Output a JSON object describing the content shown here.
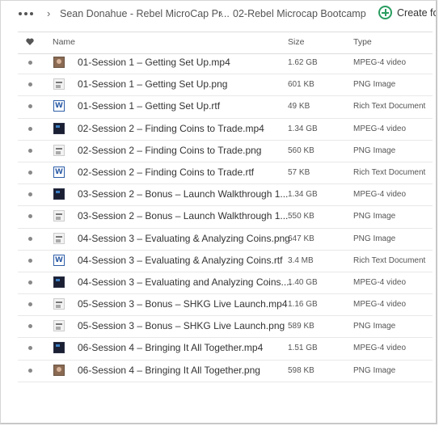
{
  "breadcrumb": {
    "items": [
      "Sean Donahue - Rebel MicroCap Pr...",
      "02-Rebel Microcap Bootcamp"
    ],
    "separator": "›"
  },
  "create": {
    "label": "Create fo"
  },
  "columns": {
    "name": "Name",
    "size": "Size",
    "type": "Type"
  },
  "colors": {
    "accent": "#2a9d60"
  },
  "files": [
    {
      "name": "01-Session 1 – Getting Set Up.mp4",
      "size": "1.62 GB",
      "type": "MPEG-4 video",
      "thumb": "photo"
    },
    {
      "name": "01-Session 1 – Getting Set Up.png",
      "size": "601 KB",
      "type": "PNG Image",
      "thumb": "png"
    },
    {
      "name": "01-Session 1 – Getting Set Up.rtf",
      "size": "49 KB",
      "type": "Rich Text Document",
      "thumb": "rtf"
    },
    {
      "name": "02-Session 2 – Finding Coins to Trade.mp4",
      "size": "1.34 GB",
      "type": "MPEG-4 video",
      "thumb": "video"
    },
    {
      "name": "02-Session 2 – Finding Coins to Trade.png",
      "size": "560 KB",
      "type": "PNG Image",
      "thumb": "png"
    },
    {
      "name": "02-Session 2 – Finding Coins to Trade.rtf",
      "size": "57 KB",
      "type": "Rich Text Document",
      "thumb": "rtf"
    },
    {
      "name": "03-Session 2 – Bonus – Launch Walkthrough 1...",
      "size": "1.34 GB",
      "type": "MPEG-4 video",
      "thumb": "video"
    },
    {
      "name": "03-Session 2 – Bonus – Launch Walkthrough 1...",
      "size": "550 KB",
      "type": "PNG Image",
      "thumb": "png"
    },
    {
      "name": "04-Session 3 – Evaluating & Analyzing Coins.png",
      "size": "647 KB",
      "type": "PNG Image",
      "thumb": "png"
    },
    {
      "name": "04-Session 3 – Evaluating & Analyzing Coins.rtf",
      "size": "3.4 MB",
      "type": "Rich Text Document",
      "thumb": "rtf"
    },
    {
      "name": "04-Session 3 – Evaluating and Analyzing Coins....",
      "size": "1.40 GB",
      "type": "MPEG-4 video",
      "thumb": "video"
    },
    {
      "name": "05-Session 3 – Bonus – SHKG Live Launch.mp4",
      "size": "1.16 GB",
      "type": "MPEG-4 video",
      "thumb": "png"
    },
    {
      "name": "05-Session 3 – Bonus – SHKG Live Launch.png",
      "size": "589 KB",
      "type": "PNG Image",
      "thumb": "png"
    },
    {
      "name": "06-Session 4 – Bringing It All Together.mp4",
      "size": "1.51 GB",
      "type": "MPEG-4 video",
      "thumb": "video"
    },
    {
      "name": "06-Session 4 – Bringing It All Together.png",
      "size": "598 KB",
      "type": "PNG Image",
      "thumb": "photo"
    }
  ]
}
